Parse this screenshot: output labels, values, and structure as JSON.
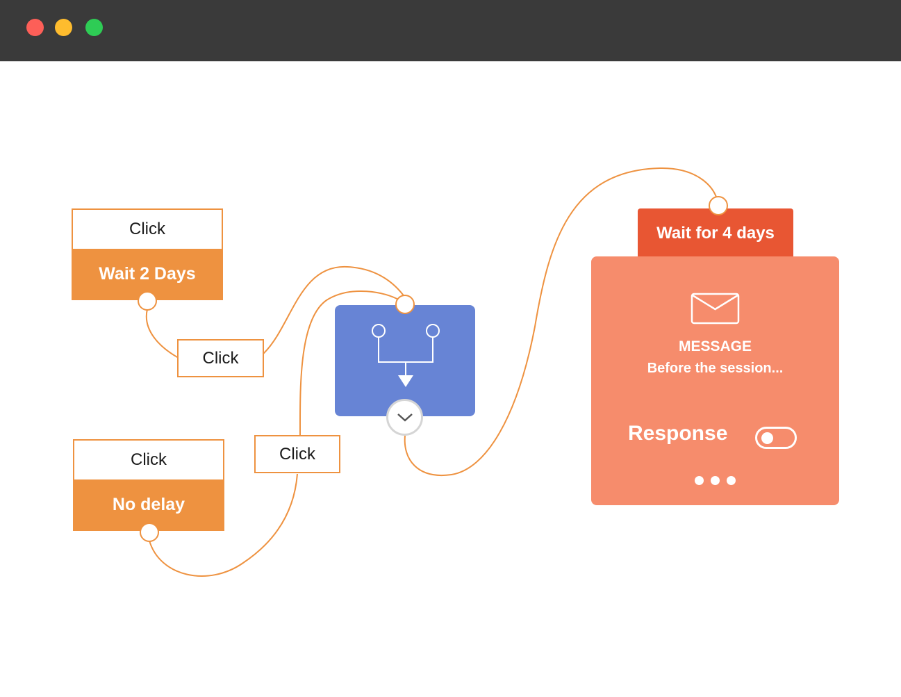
{
  "window": {
    "controls": [
      "close",
      "minimize",
      "maximize"
    ]
  },
  "colors": {
    "titlebar": "#3a3a3a",
    "close": "#fd5f58",
    "minimize": "#febc2e",
    "maximize": "#2ecc55",
    "wire": "#ee9240",
    "node_accent": "#ee9240",
    "split_node": "#6784d5",
    "wait_tab": "#e85633",
    "message_card": "#f68c6c"
  },
  "nodes": [
    {
      "trigger": "Click",
      "delay": "Wait 2 Days"
    },
    {
      "trigger": "Click",
      "delay": "No delay"
    }
  ],
  "tags": [
    {
      "label": "Click"
    },
    {
      "label": "Click"
    }
  ],
  "split": {
    "icon": "merge-arrow-icon",
    "expand_icon": "chevron-down-icon"
  },
  "message": {
    "wait_label": "Wait for 4 days",
    "icon": "envelope-icon",
    "title": "MESSAGE",
    "subtitle": "Before the session...",
    "response_label": "Response",
    "response_enabled": false,
    "more_icon": "more-dots-icon"
  }
}
